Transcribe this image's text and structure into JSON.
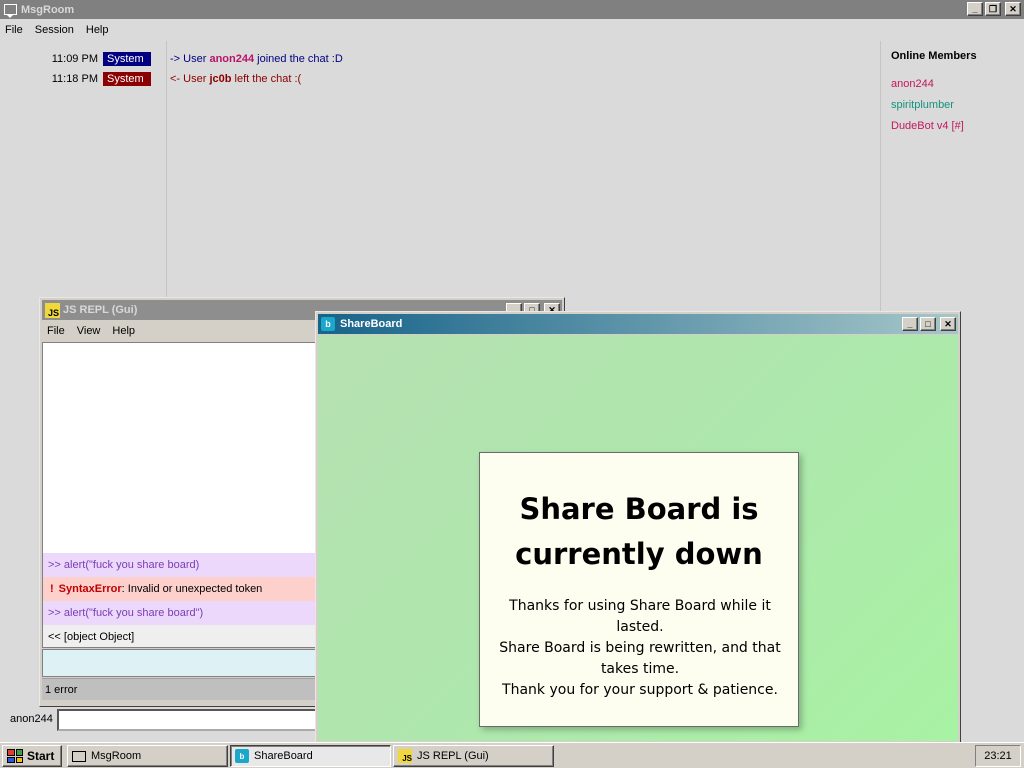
{
  "msgroom": {
    "title": "MsgRoom",
    "menu": [
      "File",
      "Session",
      "Help"
    ],
    "log": [
      {
        "time": "11:09 PM",
        "badge": "System",
        "badge_color": "#000080",
        "arrow": "->",
        "prefix": "User",
        "user": "anon244",
        "user_color": "#b8136a",
        "suffix": "joined the chat :D",
        "text_color": "#000080"
      },
      {
        "time": "11:18 PM",
        "badge": "System",
        "badge_color": "#8b0000",
        "arrow": "<-",
        "prefix": "User",
        "user": "jc0b",
        "user_color": "#8b0000",
        "suffix": "left the chat :(",
        "text_color": "#8b0000"
      }
    ],
    "members_title": "Online Members",
    "members": [
      {
        "name": "anon244",
        "color": "#c2185b"
      },
      {
        "name": "spiritplumber",
        "color": "#15917c"
      },
      {
        "name": "DudeBot v4 [#]",
        "color": "#c2185b"
      }
    ],
    "input_name": "anon244",
    "input_value": ""
  },
  "repl": {
    "title": "JS REPL (Gui)",
    "icon_text": "JS",
    "menu": [
      "File",
      "View",
      "Help"
    ],
    "lines": [
      {
        "type": "input",
        "prefix": ">>",
        "text": "alert(\"fuck you share board)"
      },
      {
        "type": "error",
        "prefix": "!",
        "name": "SyntaxError",
        "text": ": Invalid or unexpected token"
      },
      {
        "type": "input",
        "prefix": ">>",
        "text": "alert(\"fuck you share board\")"
      },
      {
        "type": "output",
        "prefix": "<<",
        "text": "[object Object]"
      }
    ],
    "status": "1 error"
  },
  "shareboard": {
    "title": "ShareBoard",
    "icon_text": "b",
    "heading_line1": "Share Board is",
    "heading_line2": "currently down",
    "body_line1": "Thanks for using Share Board while it lasted.",
    "body_line2": "Share Board is being rewritten, and that takes time.",
    "body_line3": "Thank you for your support & patience."
  },
  "taskbar": {
    "start_label": "Start",
    "buttons": [
      {
        "label": "MsgRoom",
        "icon": "chat-icon",
        "active": false
      },
      {
        "label": "ShareBoard",
        "icon": "shareboard-icon",
        "active": true
      },
      {
        "label": "JS REPL (Gui)",
        "icon": "js-icon",
        "active": false
      }
    ],
    "clock": "23:21"
  },
  "window_controls": {
    "minimize": "_",
    "maximize": "□",
    "restore": "❐",
    "close": "✕"
  }
}
